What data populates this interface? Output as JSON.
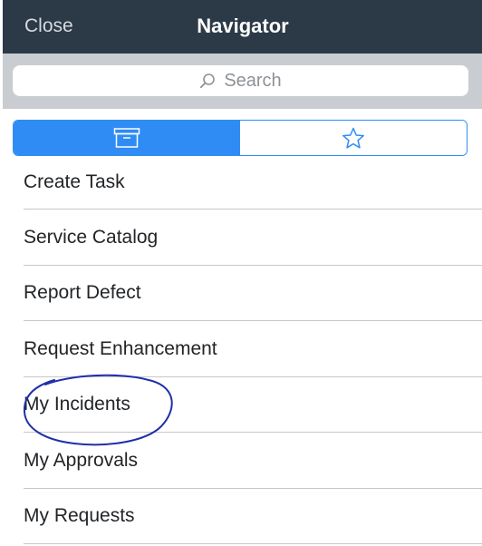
{
  "header": {
    "close_label": "Close",
    "title": "Navigator"
  },
  "search": {
    "placeholder": "Search"
  },
  "tabs": [
    {
      "icon": "archive-box-icon",
      "active": true
    },
    {
      "icon": "star-icon",
      "active": false
    }
  ],
  "menu": {
    "items": [
      {
        "label": "Create Task"
      },
      {
        "label": "Service Catalog"
      },
      {
        "label": "Report Defect"
      },
      {
        "label": "Request Enhancement"
      },
      {
        "label": "My Incidents"
      },
      {
        "label": "My Approvals"
      },
      {
        "label": "My Requests"
      }
    ]
  },
  "colors": {
    "header_bg": "#2c3947",
    "accent": "#2f8cf5",
    "annotation": "#1f2fa8"
  }
}
